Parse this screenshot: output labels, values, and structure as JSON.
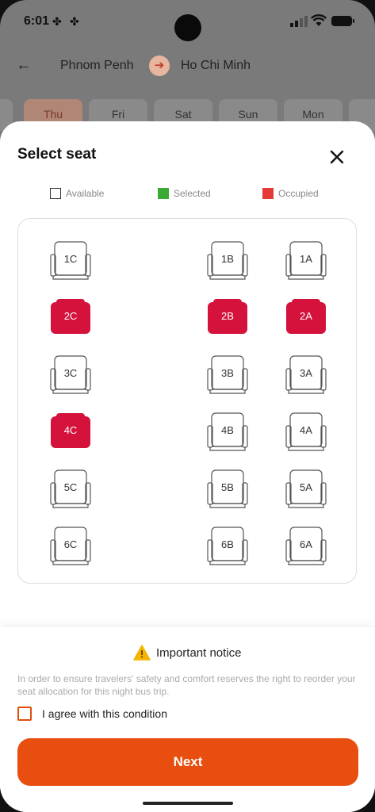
{
  "status": {
    "time": "6:01"
  },
  "header": {
    "from_city": "Phnom Penh",
    "to_city": "Ho Chi Minh"
  },
  "days": [
    {
      "label": "Thu",
      "active": true
    },
    {
      "label": "Fri",
      "active": false
    },
    {
      "label": "Sat",
      "active": false
    },
    {
      "label": "Sun",
      "active": false
    },
    {
      "label": "Mon",
      "active": false
    }
  ],
  "sheet": {
    "title": "Select seat",
    "legend": {
      "available": "Available",
      "selected": "Selected",
      "occupied": "Occupied"
    },
    "colors": {
      "occupied": "#d4123c",
      "selected": "#3aaa35",
      "accent": "#e84e0f",
      "legend_occupied": "#e53935"
    },
    "seats": [
      {
        "id": "1C",
        "status": "available"
      },
      {
        "id": "1B",
        "status": "available"
      },
      {
        "id": "1A",
        "status": "available"
      },
      {
        "id": "2C",
        "status": "occupied"
      },
      {
        "id": "2B",
        "status": "occupied"
      },
      {
        "id": "2A",
        "status": "occupied"
      },
      {
        "id": "3C",
        "status": "available"
      },
      {
        "id": "3B",
        "status": "available"
      },
      {
        "id": "3A",
        "status": "available"
      },
      {
        "id": "4C",
        "status": "occupied"
      },
      {
        "id": "4B",
        "status": "available"
      },
      {
        "id": "4A",
        "status": "available"
      },
      {
        "id": "5C",
        "status": "available"
      },
      {
        "id": "5B",
        "status": "available"
      },
      {
        "id": "5A",
        "status": "available"
      },
      {
        "id": "6C",
        "status": "available"
      },
      {
        "id": "6B",
        "status": "available"
      },
      {
        "id": "6A",
        "status": "available"
      }
    ]
  },
  "notice": {
    "title": "Important notice",
    "text": "In order to ensure travelers' safety and comfort  reserves the right to reorder your seat allocation for this night bus trip.",
    "agree_label": "I agree with this condition",
    "agreed": false
  },
  "next_button": {
    "label": "Next"
  }
}
